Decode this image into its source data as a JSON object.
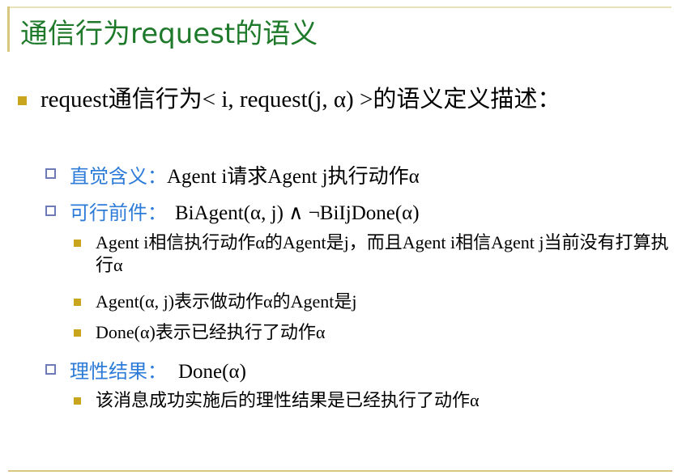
{
  "title": "通信行为request的语义",
  "intro": {
    "text": "request通信行为< i, request(j, α) >的语义定义描述："
  },
  "items": [
    {
      "label": "直觉含义：",
      "value": "Agent i请求Agent j执行动作α"
    },
    {
      "label": "可行前件：",
      "value": "BiAgent(α, j) ∧ ¬BiIjDone(α)",
      "subitems": [
        "Agent i相信执行动作α的Agent是j，而且Agent i相信Agent j当前没有打算执行α",
        "Agent(α, j)表示做动作α的Agent是j",
        "Done(α)表示已经执行了动作α"
      ]
    },
    {
      "label": "理性结果：",
      "value": "Done(α)",
      "subitems": [
        "该消息成功实施后的理性结果是已经执行了动作α"
      ]
    }
  ],
  "colors": {
    "title": "#1e7a2a",
    "label": "#2d7bd8",
    "bullet": "#c8a51c",
    "hollow_bullet": "#6e7bb8",
    "rule": "#d8c77f"
  }
}
